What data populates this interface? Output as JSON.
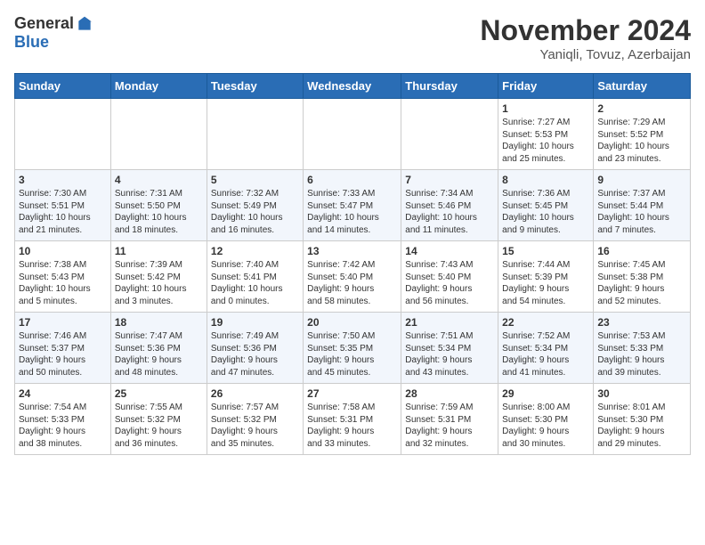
{
  "header": {
    "logo_general": "General",
    "logo_blue": "Blue",
    "month_title": "November 2024",
    "location": "Yaniqli, Tovuz, Azerbaijan"
  },
  "weekdays": [
    "Sunday",
    "Monday",
    "Tuesday",
    "Wednesday",
    "Thursday",
    "Friday",
    "Saturday"
  ],
  "weeks": [
    [
      {
        "day": "",
        "info": ""
      },
      {
        "day": "",
        "info": ""
      },
      {
        "day": "",
        "info": ""
      },
      {
        "day": "",
        "info": ""
      },
      {
        "day": "",
        "info": ""
      },
      {
        "day": "1",
        "info": "Sunrise: 7:27 AM\nSunset: 5:53 PM\nDaylight: 10 hours\nand 25 minutes."
      },
      {
        "day": "2",
        "info": "Sunrise: 7:29 AM\nSunset: 5:52 PM\nDaylight: 10 hours\nand 23 minutes."
      }
    ],
    [
      {
        "day": "3",
        "info": "Sunrise: 7:30 AM\nSunset: 5:51 PM\nDaylight: 10 hours\nand 21 minutes."
      },
      {
        "day": "4",
        "info": "Sunrise: 7:31 AM\nSunset: 5:50 PM\nDaylight: 10 hours\nand 18 minutes."
      },
      {
        "day": "5",
        "info": "Sunrise: 7:32 AM\nSunset: 5:49 PM\nDaylight: 10 hours\nand 16 minutes."
      },
      {
        "day": "6",
        "info": "Sunrise: 7:33 AM\nSunset: 5:47 PM\nDaylight: 10 hours\nand 14 minutes."
      },
      {
        "day": "7",
        "info": "Sunrise: 7:34 AM\nSunset: 5:46 PM\nDaylight: 10 hours\nand 11 minutes."
      },
      {
        "day": "8",
        "info": "Sunrise: 7:36 AM\nSunset: 5:45 PM\nDaylight: 10 hours\nand 9 minutes."
      },
      {
        "day": "9",
        "info": "Sunrise: 7:37 AM\nSunset: 5:44 PM\nDaylight: 10 hours\nand 7 minutes."
      }
    ],
    [
      {
        "day": "10",
        "info": "Sunrise: 7:38 AM\nSunset: 5:43 PM\nDaylight: 10 hours\nand 5 minutes."
      },
      {
        "day": "11",
        "info": "Sunrise: 7:39 AM\nSunset: 5:42 PM\nDaylight: 10 hours\nand 3 minutes."
      },
      {
        "day": "12",
        "info": "Sunrise: 7:40 AM\nSunset: 5:41 PM\nDaylight: 10 hours\nand 0 minutes."
      },
      {
        "day": "13",
        "info": "Sunrise: 7:42 AM\nSunset: 5:40 PM\nDaylight: 9 hours\nand 58 minutes."
      },
      {
        "day": "14",
        "info": "Sunrise: 7:43 AM\nSunset: 5:40 PM\nDaylight: 9 hours\nand 56 minutes."
      },
      {
        "day": "15",
        "info": "Sunrise: 7:44 AM\nSunset: 5:39 PM\nDaylight: 9 hours\nand 54 minutes."
      },
      {
        "day": "16",
        "info": "Sunrise: 7:45 AM\nSunset: 5:38 PM\nDaylight: 9 hours\nand 52 minutes."
      }
    ],
    [
      {
        "day": "17",
        "info": "Sunrise: 7:46 AM\nSunset: 5:37 PM\nDaylight: 9 hours\nand 50 minutes."
      },
      {
        "day": "18",
        "info": "Sunrise: 7:47 AM\nSunset: 5:36 PM\nDaylight: 9 hours\nand 48 minutes."
      },
      {
        "day": "19",
        "info": "Sunrise: 7:49 AM\nSunset: 5:36 PM\nDaylight: 9 hours\nand 47 minutes."
      },
      {
        "day": "20",
        "info": "Sunrise: 7:50 AM\nSunset: 5:35 PM\nDaylight: 9 hours\nand 45 minutes."
      },
      {
        "day": "21",
        "info": "Sunrise: 7:51 AM\nSunset: 5:34 PM\nDaylight: 9 hours\nand 43 minutes."
      },
      {
        "day": "22",
        "info": "Sunrise: 7:52 AM\nSunset: 5:34 PM\nDaylight: 9 hours\nand 41 minutes."
      },
      {
        "day": "23",
        "info": "Sunrise: 7:53 AM\nSunset: 5:33 PM\nDaylight: 9 hours\nand 39 minutes."
      }
    ],
    [
      {
        "day": "24",
        "info": "Sunrise: 7:54 AM\nSunset: 5:33 PM\nDaylight: 9 hours\nand 38 minutes."
      },
      {
        "day": "25",
        "info": "Sunrise: 7:55 AM\nSunset: 5:32 PM\nDaylight: 9 hours\nand 36 minutes."
      },
      {
        "day": "26",
        "info": "Sunrise: 7:57 AM\nSunset: 5:32 PM\nDaylight: 9 hours\nand 35 minutes."
      },
      {
        "day": "27",
        "info": "Sunrise: 7:58 AM\nSunset: 5:31 PM\nDaylight: 9 hours\nand 33 minutes."
      },
      {
        "day": "28",
        "info": "Sunrise: 7:59 AM\nSunset: 5:31 PM\nDaylight: 9 hours\nand 32 minutes."
      },
      {
        "day": "29",
        "info": "Sunrise: 8:00 AM\nSunset: 5:30 PM\nDaylight: 9 hours\nand 30 minutes."
      },
      {
        "day": "30",
        "info": "Sunrise: 8:01 AM\nSunset: 5:30 PM\nDaylight: 9 hours\nand 29 minutes."
      }
    ]
  ]
}
